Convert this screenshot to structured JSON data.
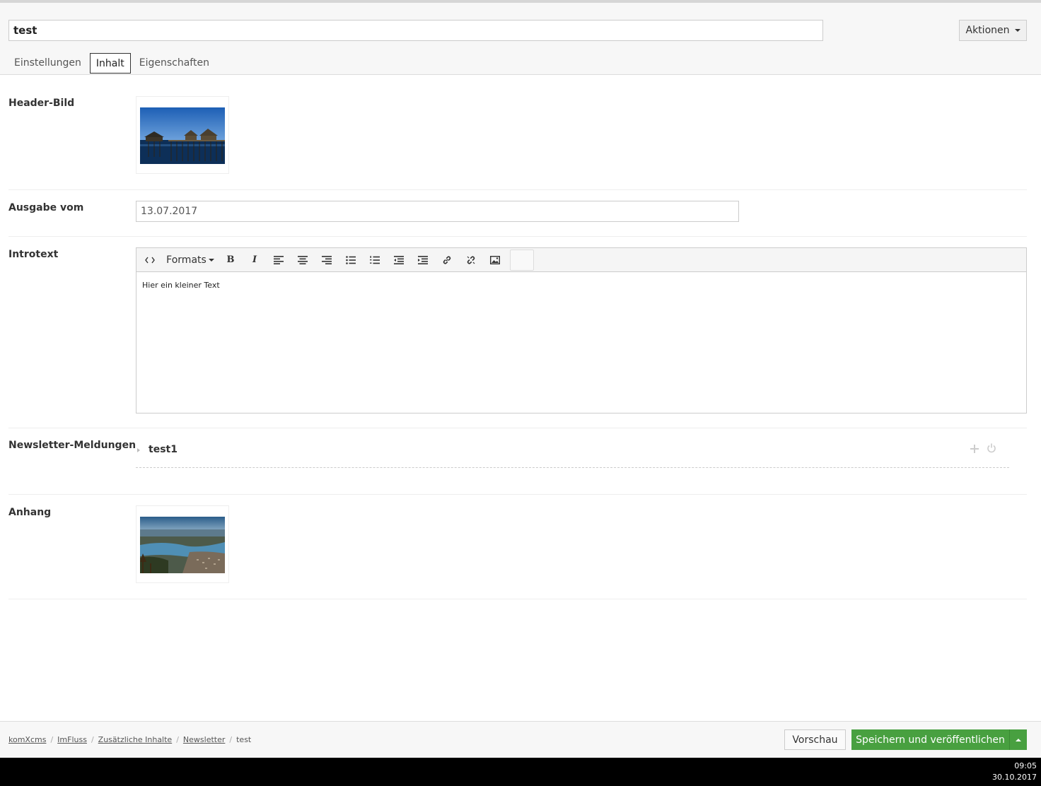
{
  "header": {
    "title_value": "test",
    "actions_label": "Aktionen",
    "tabs": [
      {
        "label": "Einstellungen"
      },
      {
        "label": "Inhalt",
        "active": true
      },
      {
        "label": "Eigenschaften"
      }
    ]
  },
  "fields": {
    "header_image": {
      "label": "Header-Bild"
    },
    "issue_date": {
      "label": "Ausgabe vom",
      "value": "13.07.2017"
    },
    "intro_text": {
      "label": "Introtext",
      "toolbar": {
        "formats_label": "Formats",
        "buttons": [
          "source-code-icon",
          "bold-icon",
          "italic-icon",
          "align-left-icon",
          "align-center-icon",
          "align-right-icon",
          "bullet-list-icon",
          "numbered-list-icon",
          "outdent-icon",
          "indent-icon",
          "link-icon",
          "unlink-icon",
          "image-icon"
        ],
        "bold_glyph": "B",
        "italic_glyph": "I"
      },
      "content": "Hier ein kleiner Text"
    },
    "newsletter_items": {
      "label": "Newsletter-Meldungen",
      "items": [
        {
          "label": "test1"
        }
      ]
    },
    "attachment": {
      "label": "Anhang"
    }
  },
  "footer": {
    "breadcrumb": [
      "komXcms",
      "ImFluss",
      "Zusätzliche Inhalte",
      "Newsletter",
      "test"
    ],
    "preview_label": "Vorschau",
    "save_label": "Speichern und veröffentlichen"
  },
  "taskbar": {
    "time": "09:05",
    "date": "30.10.2017"
  },
  "colors": {
    "accent_green": "#48a040"
  }
}
